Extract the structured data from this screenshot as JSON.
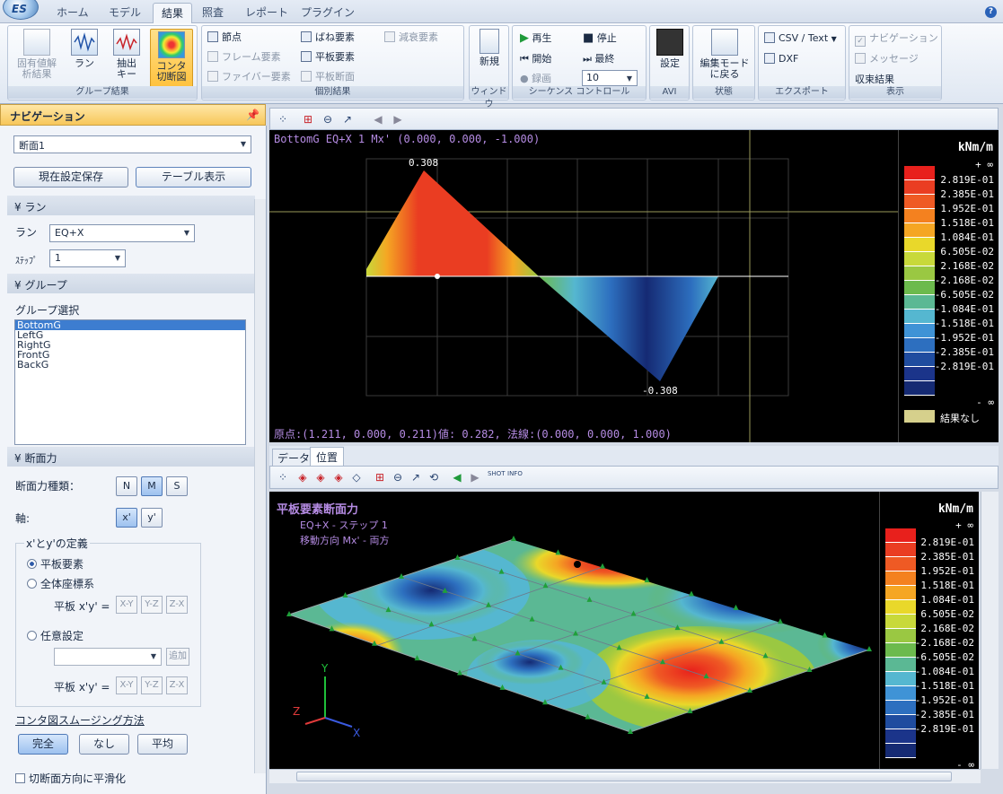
{
  "app": {
    "tabs": [
      "ホーム",
      "モデル",
      "結果",
      "照査",
      "レポート",
      "プラグイン"
    ],
    "active_tab": "結果",
    "logo_text": "ES"
  },
  "ribbon": {
    "group_result": {
      "label": "グループ結果",
      "buttons": [
        "固有値解\n析結果",
        "ラン",
        "抽出\nキー",
        "コンタ\n切断図"
      ]
    },
    "group_individual": {
      "label": "個別結果",
      "items": [
        "節点",
        "フレーム要素",
        "ファイバー要素",
        "ばね要素",
        "平板要素",
        "平板断面",
        "減衰要素"
      ]
    },
    "group_window": {
      "label": "ウィンドウ",
      "button": "新規"
    },
    "group_sequence": {
      "label": "シーケンス コントロール",
      "play": "再生",
      "stop": "停止",
      "start": "開始",
      "end": "最終",
      "record": "録画",
      "value": "10"
    },
    "group_avi": {
      "label": "AVI",
      "button": "設定"
    },
    "group_state": {
      "label": "状態",
      "button": "編集モード\nに戻る"
    },
    "group_export": {
      "label": "エクスポート",
      "csv": "CSV / Text",
      "dxf": "DXF"
    },
    "group_display": {
      "label": "表示",
      "nav": "ナビゲーション",
      "msg": "メッセージ",
      "conv": "収束結果"
    }
  },
  "nav": {
    "title": "ナビゲーション",
    "section_select": "断面1",
    "save_btn": "現在設定保存",
    "table_btn": "テーブル表示",
    "run_section": "ラン",
    "run_label": "ラン",
    "run_value": "EQ+X",
    "step_label": "ｽﾃｯﾌﾟ",
    "step_value": "1",
    "group_section": "グループ",
    "group_select_label": "グループ選択",
    "groups": [
      "BottomG",
      "LeftG",
      "RightG",
      "FrontG",
      "BackG"
    ],
    "force_section": "断面力",
    "force_type_label": "断面力種類：",
    "force_types": [
      "N",
      "M",
      "S"
    ],
    "axis_label": "軸:",
    "axes": [
      "x'",
      "y'"
    ],
    "def_title": "x'とy'の定義",
    "radio_plate": "平板要素",
    "radio_global": "全体座標系",
    "plate_xy_label": "平板 x'y' =",
    "plane_btns": [
      "X-Y",
      "Y-Z",
      "Z-X"
    ],
    "radio_any": "任意設定",
    "add_btn": "追加",
    "smooth_title": "コンタ図スムージング方法",
    "smooth_btns": [
      "完全",
      "なし",
      "平均"
    ],
    "smooth_check": "切断面方向に平滑化"
  },
  "top_view": {
    "header": "BottomG EQ+X 1 Mx'  (0.000, 0.000, -1.000)",
    "max_label": "0.308",
    "min_label": "-0.308",
    "footer": "原点:(1.211, 0.000, 0.211)値: 0.282, 法線:(0.000, 0.000, 1.000)",
    "unit": "kNm/m",
    "no_result": "結果なし"
  },
  "legend": {
    "top": "+ ∞",
    "values": [
      "2.819E-01",
      "2.385E-01",
      "1.952E-01",
      "1.518E-01",
      "1.084E-01",
      "6.505E-02",
      "2.168E-02",
      "-2.168E-02",
      "-6.505E-02",
      "-1.084E-01",
      "-1.518E-01",
      "-1.952E-01",
      "-2.385E-01",
      "-2.819E-01"
    ],
    "bottom": "- ∞",
    "colors": [
      "#e8201c",
      "#ea3d22",
      "#ef5a24",
      "#f4811f",
      "#f5a623",
      "#e9d82a",
      "#c8d93a",
      "#9ac842",
      "#6cba4d",
      "#5bb894",
      "#55b7d0",
      "#3f93d6",
      "#2d6fbf",
      "#1f4c9f",
      "#1b348a",
      "#152a73"
    ]
  },
  "lower": {
    "tabs": [
      "データ",
      "位置"
    ],
    "active_tab": "位置",
    "title": "平板要素断面力",
    "line1": "EQ+X - ステップ 1",
    "line2": "移動方向 Mx' - 両方",
    "unit": "kNm/m",
    "tool_labels": [
      "SHOT",
      "INFO"
    ]
  },
  "axes3d": {
    "x": "X",
    "y": "Y",
    "z": "Z"
  }
}
